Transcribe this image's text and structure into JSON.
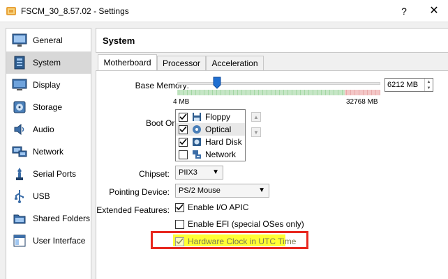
{
  "window": {
    "title": "FSCM_30_8.57.02 - Settings",
    "help_label": "?",
    "close_label": "✕"
  },
  "sidebar": {
    "items": [
      {
        "label": "General",
        "icon": "monitor-icon"
      },
      {
        "label": "System",
        "icon": "motherboard-icon"
      },
      {
        "label": "Display",
        "icon": "display-icon"
      },
      {
        "label": "Storage",
        "icon": "disk-icon"
      },
      {
        "label": "Audio",
        "icon": "speaker-icon"
      },
      {
        "label": "Network",
        "icon": "network-icon"
      },
      {
        "label": "Serial Ports",
        "icon": "serial-port-icon"
      },
      {
        "label": "USB",
        "icon": "usb-icon"
      },
      {
        "label": "Shared Folders",
        "icon": "folder-icon"
      },
      {
        "label": "User Interface",
        "icon": "window-icon"
      }
    ],
    "selected": "System"
  },
  "section": {
    "title": "System"
  },
  "tabs": [
    {
      "label": "Motherboard",
      "active": true
    },
    {
      "label": "Processor",
      "active": false
    },
    {
      "label": "Acceleration",
      "active": false
    }
  ],
  "motherboard": {
    "base_memory": {
      "label": "Base Memory:",
      "value": "6212 MB",
      "value_mb": 6212,
      "min_label": "4 MB",
      "max_label": "32768 MB"
    },
    "boot_order": {
      "label": "Boot Order:",
      "items": [
        {
          "label": "Floppy",
          "checked": true,
          "icon": "floppy-icon"
        },
        {
          "label": "Optical",
          "checked": true,
          "icon": "optical-icon"
        },
        {
          "label": "Hard Disk",
          "checked": true,
          "icon": "hard-disk-icon"
        },
        {
          "label": "Network",
          "checked": false,
          "icon": "network-icon"
        }
      ]
    },
    "chipset": {
      "label": "Chipset:",
      "value": "PIIX3"
    },
    "pointing_device": {
      "label": "Pointing Device:",
      "value": "PS/2 Mouse"
    },
    "extended_features": {
      "label": "Extended Features:",
      "ioapic": {
        "label": "Enable I/O APIC",
        "checked": true
      },
      "efi": {
        "label": "Enable EFI (special OSes only)",
        "checked": false
      },
      "utc": {
        "label": "Hardware Clock in UTC Time",
        "checked": true
      }
    }
  },
  "colors": {
    "highlight_border": "#e8281f",
    "highlight_fill": "#ffff33",
    "slider_handle": "#1f6fd1"
  }
}
